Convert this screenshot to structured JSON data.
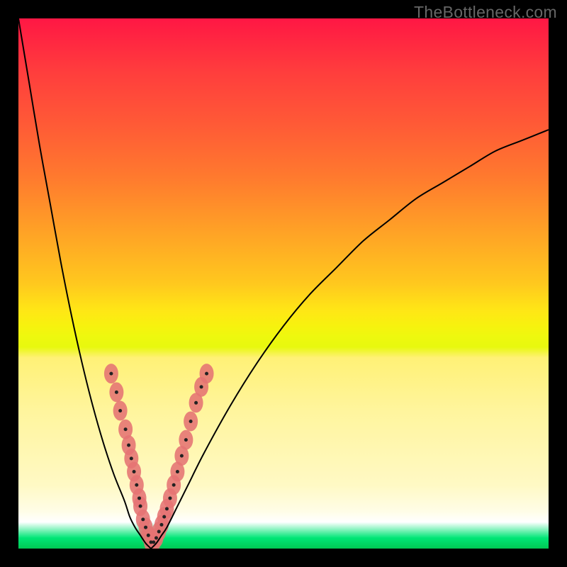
{
  "watermark": "TheBottleneck.com",
  "chart_data": {
    "type": "line",
    "title": "",
    "xlabel": "",
    "ylabel": "",
    "x_range": [
      0,
      100
    ],
    "y_range": [
      0,
      100
    ],
    "series": [
      {
        "name": "left-curve",
        "x": [
          0,
          2,
          4,
          6,
          8,
          10,
          12,
          14,
          16,
          18,
          20,
          21,
          22,
          23,
          24,
          25
        ],
        "y": [
          100,
          88,
          76,
          65,
          54,
          44,
          35,
          27,
          20,
          14,
          9,
          6,
          4,
          2.5,
          1,
          0
        ]
      },
      {
        "name": "right-curve",
        "x": [
          25,
          26,
          27,
          28,
          30,
          32,
          35,
          40,
          45,
          50,
          55,
          60,
          65,
          70,
          75,
          80,
          85,
          90,
          95,
          100
        ],
        "y": [
          0,
          1,
          2.5,
          4,
          8,
          12,
          18,
          27,
          35,
          42,
          48,
          53,
          58,
          62,
          66,
          69,
          72,
          75,
          77,
          79
        ]
      }
    ],
    "point_clusters": [
      {
        "name": "left-branch-points",
        "points": [
          {
            "x": 17.5,
            "y": 33
          },
          {
            "x": 18.5,
            "y": 29.5
          },
          {
            "x": 19.2,
            "y": 26
          },
          {
            "x": 20.2,
            "y": 22.5
          },
          {
            "x": 20.8,
            "y": 19.5
          },
          {
            "x": 21.3,
            "y": 17
          },
          {
            "x": 21.8,
            "y": 14.5
          },
          {
            "x": 22.3,
            "y": 12
          },
          {
            "x": 22.8,
            "y": 9.5
          },
          {
            "x": 23,
            "y": 8
          }
        ]
      },
      {
        "name": "right-branch-points",
        "points": [
          {
            "x": 28,
            "y": 7.5
          },
          {
            "x": 28.6,
            "y": 9.5
          },
          {
            "x": 29.3,
            "y": 12
          },
          {
            "x": 30,
            "y": 14.5
          },
          {
            "x": 30.8,
            "y": 17.5
          },
          {
            "x": 31.6,
            "y": 20.5
          },
          {
            "x": 32.5,
            "y": 24
          },
          {
            "x": 33.5,
            "y": 27.5
          },
          {
            "x": 34.5,
            "y": 30.5
          },
          {
            "x": 35.5,
            "y": 33
          }
        ]
      },
      {
        "name": "valley-points",
        "points": [
          {
            "x": 23.5,
            "y": 5.5
          },
          {
            "x": 24,
            "y": 4
          },
          {
            "x": 24.5,
            "y": 2.5
          },
          {
            "x": 25,
            "y": 1.2
          },
          {
            "x": 25.5,
            "y": 1.2
          },
          {
            "x": 26,
            "y": 2
          },
          {
            "x": 26.5,
            "y": 3.2
          },
          {
            "x": 27,
            "y": 4.5
          },
          {
            "x": 27.5,
            "y": 6
          }
        ]
      }
    ],
    "gradient_stops": [
      {
        "pos": 0,
        "color": "#ff1744"
      },
      {
        "pos": 50,
        "color": "#ffc81e"
      },
      {
        "pos": 95,
        "color": "#ffffff"
      },
      {
        "pos": 100,
        "color": "#00c853"
      }
    ]
  }
}
